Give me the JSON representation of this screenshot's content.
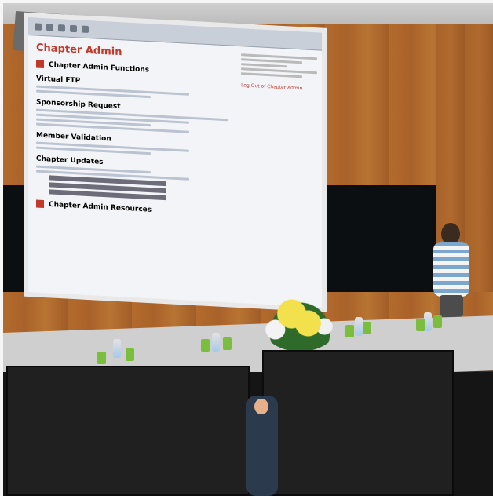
{
  "screen": {
    "page_title": "Chapter Admin",
    "section_title": "Chapter Admin Functions",
    "section_1": "Virtual FTP",
    "section_2": "Sponsorship Request",
    "section_3": "Member Validation",
    "section_4": "Chapter Updates",
    "footer_title": "Chapter Admin Resources",
    "side_link": "Log Out of Chapter Admin"
  }
}
